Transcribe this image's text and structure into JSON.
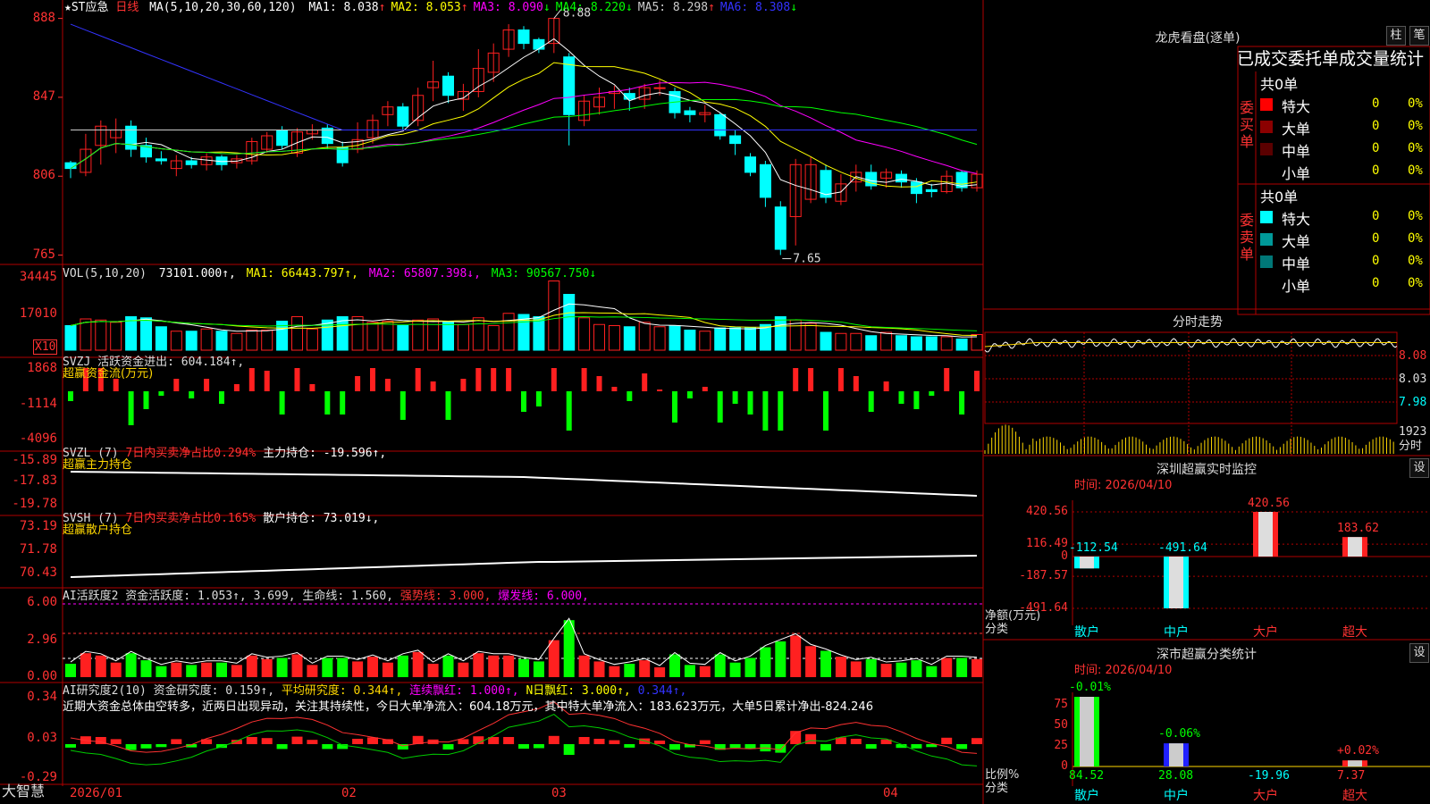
{
  "stock": {
    "name": "★ST应急",
    "period": "日线",
    "ma_label": "MA(5,10,20,30,60,120)",
    "ma_values": [
      {
        "label": "MA1:",
        "value": "8.038",
        "arrow": "↑",
        "color": "#ffffff"
      },
      {
        "label": "MA2:",
        "value": "8.053",
        "arrow": "↑",
        "color": "#ffff00"
      },
      {
        "label": "MA3:",
        "value": "8.090",
        "arrow": "↓",
        "color": "#ff00ff"
      },
      {
        "label": "MA4:",
        "value": "8.220",
        "arrow": "↓",
        "color": "#00ff00"
      },
      {
        "label": "MA5:",
        "value": "8.298",
        "arrow": "↑",
        "color": "#cccccc"
      },
      {
        "label": "MA6:",
        "value": "8.308",
        "arrow": "↓",
        "color": "#3333ff"
      }
    ],
    "high_label": "8.88",
    "low_label": "7.65",
    "price_axis": [
      "888",
      "847",
      "806",
      "765"
    ],
    "colors": {
      "up": "#ff2020",
      "down": "#00ffff",
      "grid": "#b00000",
      "axis_text": "#ff3232"
    }
  },
  "candles": [
    {
      "o": 8.13,
      "c": 8.1,
      "h": 8.14,
      "l": 8.05,
      "v": 22
    },
    {
      "o": 8.08,
      "c": 8.2,
      "h": 8.28,
      "l": 8.06,
      "v": 28
    },
    {
      "o": 8.22,
      "c": 8.32,
      "h": 8.35,
      "l": 8.12,
      "v": 27
    },
    {
      "o": 8.26,
      "c": 8.3,
      "h": 8.36,
      "l": 8.18,
      "v": 25
    },
    {
      "o": 8.32,
      "c": 8.2,
      "h": 8.35,
      "l": 8.16,
      "v": 30
    },
    {
      "o": 8.22,
      "c": 8.16,
      "h": 8.26,
      "l": 8.13,
      "v": 29
    },
    {
      "o": 8.15,
      "c": 8.14,
      "h": 8.19,
      "l": 8.12,
      "v": 21
    },
    {
      "o": 8.1,
      "c": 8.14,
      "h": 8.17,
      "l": 8.06,
      "v": 17
    },
    {
      "o": 8.14,
      "c": 8.12,
      "h": 8.16,
      "l": 8.1,
      "v": 17
    },
    {
      "o": 8.12,
      "c": 8.16,
      "h": 8.18,
      "l": 8.09,
      "v": 19
    },
    {
      "o": 8.16,
      "c": 8.12,
      "h": 8.17,
      "l": 8.09,
      "v": 17
    },
    {
      "o": 8.13,
      "c": 8.15,
      "h": 8.17,
      "l": 8.1,
      "v": 15
    },
    {
      "o": 8.14,
      "c": 8.24,
      "h": 8.26,
      "l": 8.12,
      "v": 18
    },
    {
      "o": 8.2,
      "c": 8.27,
      "h": 8.29,
      "l": 8.18,
      "v": 18
    },
    {
      "o": 8.3,
      "c": 8.22,
      "h": 8.32,
      "l": 8.2,
      "v": 26
    },
    {
      "o": 8.18,
      "c": 8.29,
      "h": 8.31,
      "l": 8.16,
      "v": 30
    },
    {
      "o": 8.28,
      "c": 8.3,
      "h": 8.33,
      "l": 8.25,
      "v": 19
    },
    {
      "o": 8.31,
      "c": 8.23,
      "h": 8.33,
      "l": 8.2,
      "v": 27
    },
    {
      "o": 8.21,
      "c": 8.13,
      "h": 8.24,
      "l": 8.11,
      "v": 30
    },
    {
      "o": 8.2,
      "c": 8.25,
      "h": 8.34,
      "l": 8.18,
      "v": 30
    },
    {
      "o": 8.26,
      "c": 8.35,
      "h": 8.38,
      "l": 8.23,
      "v": 25
    },
    {
      "o": 8.38,
      "c": 8.42,
      "h": 8.45,
      "l": 8.32,
      "v": 26
    },
    {
      "o": 8.42,
      "c": 8.32,
      "h": 8.44,
      "l": 8.3,
      "v": 22
    },
    {
      "o": 8.35,
      "c": 8.48,
      "h": 8.52,
      "l": 8.32,
      "v": 27
    },
    {
      "o": 8.52,
      "c": 8.55,
      "h": 8.66,
      "l": 8.45,
      "v": 28
    },
    {
      "o": 8.58,
      "c": 8.48,
      "h": 8.6,
      "l": 8.44,
      "v": 26
    },
    {
      "o": 8.46,
      "c": 8.5,
      "h": 8.54,
      "l": 8.4,
      "v": 23
    },
    {
      "o": 8.5,
      "c": 8.62,
      "h": 8.72,
      "l": 8.47,
      "v": 29
    },
    {
      "o": 8.6,
      "c": 8.7,
      "h": 8.75,
      "l": 8.55,
      "v": 22
    },
    {
      "o": 8.72,
      "c": 8.82,
      "h": 8.85,
      "l": 8.68,
      "v": 33
    },
    {
      "o": 8.82,
      "c": 8.75,
      "h": 8.84,
      "l": 8.72,
      "v": 32
    },
    {
      "o": 8.77,
      "c": 8.72,
      "h": 8.78,
      "l": 8.7,
      "v": 30
    },
    {
      "o": 8.75,
      "c": 8.88,
      "h": 8.88,
      "l": 8.7,
      "v": 62
    },
    {
      "o": 8.68,
      "c": 8.38,
      "h": 8.7,
      "l": 8.22,
      "v": 50
    },
    {
      "o": 8.35,
      "c": 8.45,
      "h": 8.48,
      "l": 8.32,
      "v": 29
    },
    {
      "o": 8.42,
      "c": 8.47,
      "h": 8.52,
      "l": 8.38,
      "v": 23
    },
    {
      "o": 8.49,
      "c": 8.5,
      "h": 8.53,
      "l": 8.41,
      "v": 22
    },
    {
      "o": 8.49,
      "c": 8.46,
      "h": 8.52,
      "l": 8.4,
      "v": 21
    },
    {
      "o": 8.46,
      "c": 8.52,
      "h": 8.54,
      "l": 8.41,
      "v": 25
    },
    {
      "o": 8.52,
      "c": 8.52,
      "h": 8.56,
      "l": 8.48,
      "v": 21
    },
    {
      "o": 8.5,
      "c": 8.39,
      "h": 8.52,
      "l": 8.36,
      "v": 22
    },
    {
      "o": 8.4,
      "c": 8.38,
      "h": 8.42,
      "l": 8.34,
      "v": 18
    },
    {
      "o": 8.38,
      "c": 8.39,
      "h": 8.43,
      "l": 8.34,
      "v": 17
    },
    {
      "o": 8.38,
      "c": 8.27,
      "h": 8.39,
      "l": 8.25,
      "v": 20
    },
    {
      "o": 8.27,
      "c": 8.23,
      "h": 8.3,
      "l": 8.17,
      "v": 20
    },
    {
      "o": 8.16,
      "c": 8.08,
      "h": 8.18,
      "l": 8.06,
      "v": 20
    },
    {
      "o": 8.12,
      "c": 7.95,
      "h": 8.14,
      "l": 7.9,
      "v": 23
    },
    {
      "o": 7.9,
      "c": 7.68,
      "h": 7.93,
      "l": 7.65,
      "v": 30
    },
    {
      "o": 7.85,
      "c": 8.12,
      "h": 8.15,
      "l": 7.7,
      "v": 27
    },
    {
      "o": 7.94,
      "c": 8.12,
      "h": 8.16,
      "l": 7.92,
      "v": 24
    },
    {
      "o": 8.09,
      "c": 7.95,
      "h": 8.12,
      "l": 7.92,
      "v": 16
    },
    {
      "o": 7.93,
      "c": 8.02,
      "h": 8.07,
      "l": 7.91,
      "v": 15
    },
    {
      "o": 8.03,
      "c": 8.08,
      "h": 8.12,
      "l": 7.98,
      "v": 15
    },
    {
      "o": 8.08,
      "c": 8.01,
      "h": 8.12,
      "l": 7.99,
      "v": 13
    },
    {
      "o": 8.05,
      "c": 8.08,
      "h": 8.1,
      "l": 8.0,
      "v": 16
    },
    {
      "o": 8.07,
      "c": 8.03,
      "h": 8.09,
      "l": 8.0,
      "v": 13
    },
    {
      "o": 8.03,
      "c": 7.97,
      "h": 8.05,
      "l": 7.92,
      "v": 12
    },
    {
      "o": 7.99,
      "c": 7.98,
      "h": 8.02,
      "l": 7.95,
      "v": 12
    },
    {
      "o": 7.98,
      "c": 8.06,
      "h": 8.09,
      "l": 7.97,
      "v": 12
    },
    {
      "o": 8.08,
      "c": 8.0,
      "h": 8.09,
      "l": 7.98,
      "v": 10
    },
    {
      "o": 8.0,
      "c": 8.07,
      "h": 8.09,
      "l": 7.98,
      "v": 14
    }
  ],
  "price_range": [
    7.62,
    8.92
  ],
  "vol_panel": {
    "label": "VOL(5,10,20)",
    "value": "73101.000↑,",
    "ma1": "MA1: 66443.797↑,",
    "ma2": "MA2: 65807.398↓,",
    "ma3": "MA3: 90567.750↓",
    "axis": [
      "34445",
      "17010"
    ],
    "unit": "X10"
  },
  "svzj_panel": {
    "label": "SVZJ  活跃资金进出: 604.184↑,",
    "sub": "超赢资金流(万元)",
    "axis": [
      "1868",
      "-1114",
      "-4096"
    ]
  },
  "svzl_panel": {
    "label": "SVZL (7)",
    "ratio": "7日内买卖净占比0.294%",
    "holding": "主力持仓: -19.596↑,",
    "sub": "超赢主力持仓",
    "axis": [
      "-15.89",
      "-17.83",
      "-19.78"
    ]
  },
  "svsh_panel": {
    "label": "SVSH (7)",
    "ratio": "7日内买卖净占比0.165%",
    "holding": "散户持仓: 73.019↓,",
    "sub": "超赢散户持仓",
    "axis": [
      "73.19",
      "71.78",
      "70.43"
    ]
  },
  "ai1_panel": {
    "label": "AI活跃度2 资金活跃度: 1.053↑, 3.699, 生命线: 1.560,",
    "strong": "强势线: 3.000,",
    "burst": "爆发线: 6.000,",
    "axis": [
      "6.00",
      "2.96",
      "0.00"
    ]
  },
  "ai2_panel": {
    "label": "AI研究度2(10) 资金研究度: 0.159↑,",
    "avg": "平均研究度: 0.344↑,",
    "red": "连续飘红: 1.000↑,",
    "nred": "N日飘红: 3.000↑,",
    "last": "0.344↑,",
    "comment": "近期大资金总体由空转多，近两日出现异动，关注其持续性，今日大单净流入：604.18万元，其中特大单净流入：183.623万元，大单5日累计净出-824.246",
    "axis": [
      "0.34",
      "0.03",
      "-0.29"
    ]
  },
  "date_axis": [
    "2026/01",
    "02",
    "03",
    "04"
  ],
  "brand": "大智慧",
  "right": {
    "dragon_title": "龙虎看盘(逐单)",
    "btn_zhu": "柱",
    "btn_bi": "笔",
    "stats_title": "已成交委托单成交量统计",
    "buy": {
      "side": "委买单",
      "total": "共0单",
      "rows": [
        {
          "name": "特大",
          "count": "0",
          "pct": "0%",
          "color": "#ff0000"
        },
        {
          "name": "大单",
          "count": "0",
          "pct": "0%",
          "color": "#8b0000"
        },
        {
          "name": "中单",
          "count": "0",
          "pct": "0%",
          "color": "#5a0000"
        },
        {
          "name": "小单",
          "count": "0",
          "pct": "0%",
          "color": "#000000"
        }
      ]
    },
    "sell": {
      "side": "委卖单",
      "total": "共0单",
      "rows": [
        {
          "name": "特大",
          "count": "0",
          "pct": "0%",
          "color": "#00ffff"
        },
        {
          "name": "大单",
          "count": "0",
          "pct": "0%",
          "color": "#009999"
        },
        {
          "name": "中单",
          "count": "0",
          "pct": "0%",
          "color": "#007777"
        },
        {
          "name": "小单",
          "count": "0",
          "pct": "0%",
          "color": "#000000"
        }
      ]
    },
    "intraday_title": "分时走势",
    "intraday_axis": [
      "8.08",
      "8.03",
      "7.98",
      "1923"
    ],
    "intraday_unit": "分时",
    "monitor": {
      "title": "深圳超赢实时监控",
      "btn": "设",
      "time": "时间: 2026/04/10",
      "ylabel": "净额(万元)",
      "xlabel": "分类",
      "axis": [
        "420.56",
        "116.49",
        "0",
        "-187.57",
        "-491.64"
      ],
      "categories": [
        "散户",
        "中户",
        "大户",
        "超大"
      ],
      "values": [
        -112.54,
        -491.64,
        420.56,
        183.62
      ],
      "value_labels": [
        "-112.54",
        "-491.64",
        "420.56",
        "183.62"
      ]
    },
    "classify": {
      "title": "深市超赢分类统计",
      "btn": "设",
      "time": "时间: 2026/04/10",
      "ylabel": "比例%",
      "xlabel": "分类",
      "axis": [
        "75",
        "50",
        "25",
        "0"
      ],
      "categories": [
        "散户",
        "中户",
        "大户",
        "超大"
      ],
      "pct_labels": [
        "-0.01%",
        "-0.06%",
        "",
        "+0.02%"
      ],
      "values": [
        84.52,
        28.08,
        -19.96,
        7.37
      ],
      "value_labels": [
        "84.52",
        "28.08",
        "-19.96",
        "7.37"
      ]
    }
  }
}
